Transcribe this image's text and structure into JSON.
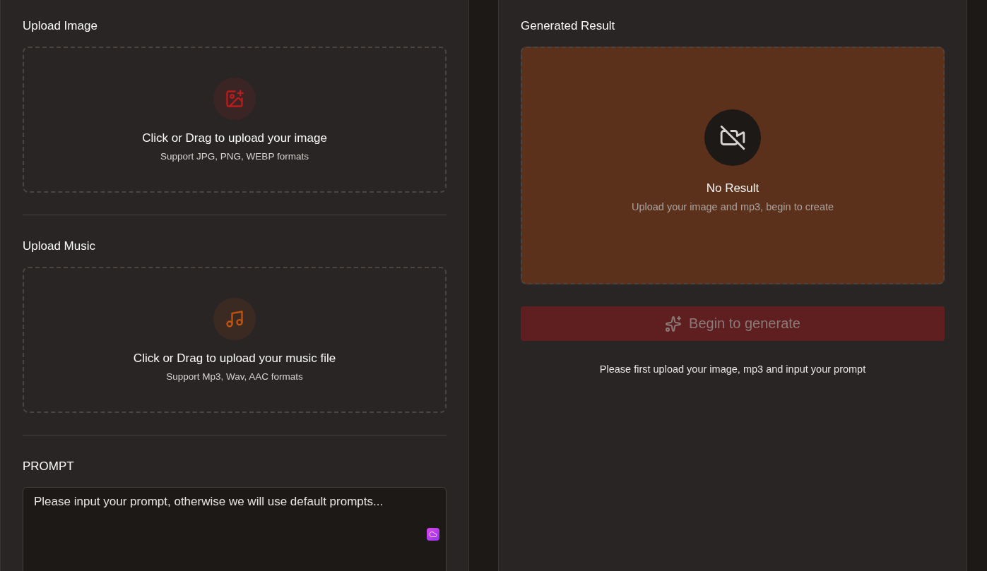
{
  "left_panel": {
    "sections": [
      {
        "kind": "image",
        "label": "Upload Image",
        "title": "Click or Drag to upload your image",
        "hint": "Support JPG, PNG, WEBP formats"
      },
      {
        "kind": "music",
        "label": "Upload Music",
        "title": "Click or Drag to upload your music file",
        "hint": "Support Mp3, Wav, AAC formats"
      },
      {
        "kind": "prompt",
        "label": "PROMPT",
        "placeholder": "Please input your prompt, otherwise we will use default prompts..."
      }
    ]
  },
  "right_panel": {
    "label": "Generated Result",
    "result": {
      "title": "No Result",
      "subtitle": "Upload your image and mp3, begin to create"
    },
    "generate_button": {
      "label": "Begin to generate",
      "disabled": true
    },
    "note": "Please first upload your image, mp3 and input your prompt"
  }
}
